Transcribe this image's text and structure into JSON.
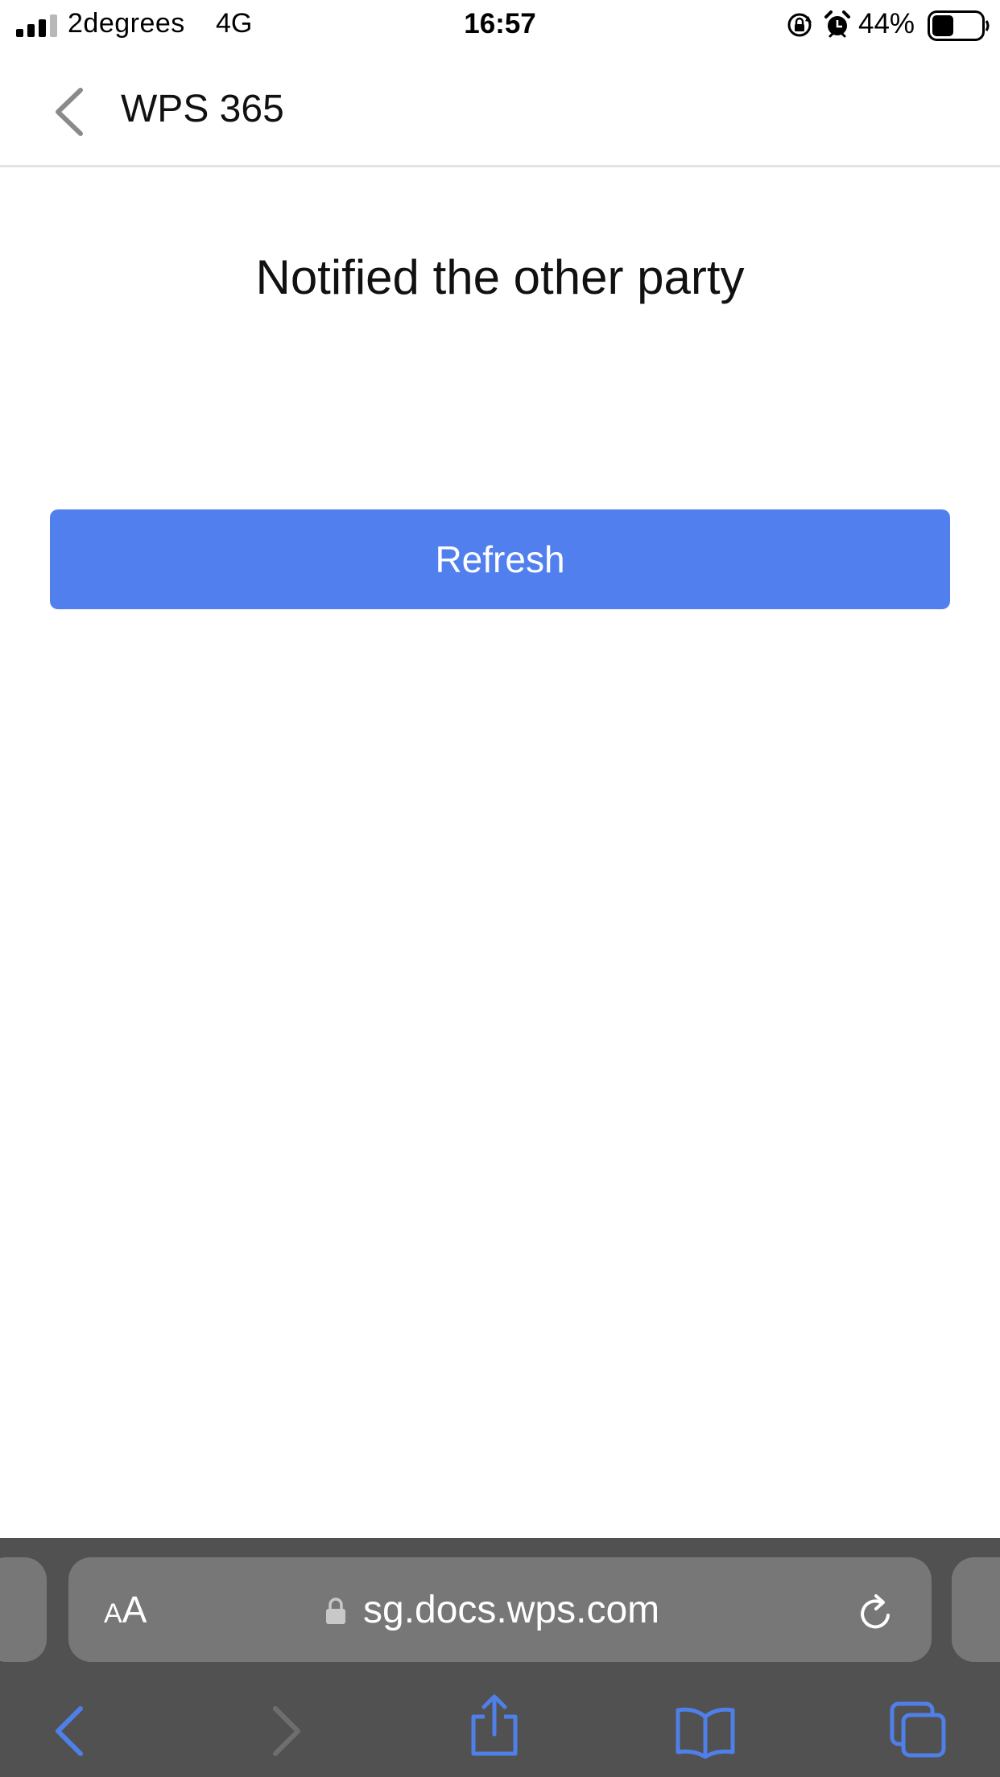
{
  "status_bar": {
    "carrier": "2degrees",
    "network": "4G",
    "time": "16:57",
    "battery_percent": "44%",
    "battery_level": 0.44
  },
  "header": {
    "title": "WPS 365"
  },
  "main": {
    "message": "Notified the other party",
    "refresh_label": "Refresh"
  },
  "browser": {
    "text_size_small": "A",
    "text_size_big": "A",
    "url": "sg.docs.wps.com"
  },
  "colors": {
    "accent": "#5180EE",
    "toolbar_bg": "#515151",
    "address_bg": "#777777",
    "toolbar_icon": "#4F7FE8"
  },
  "icons": {
    "status": [
      "signal-icon",
      "lock-rotation-icon",
      "alarm-icon",
      "battery-icon"
    ],
    "toolbar": [
      "back-icon",
      "forward-icon",
      "share-icon",
      "bookmarks-icon",
      "tabs-icon"
    ]
  }
}
